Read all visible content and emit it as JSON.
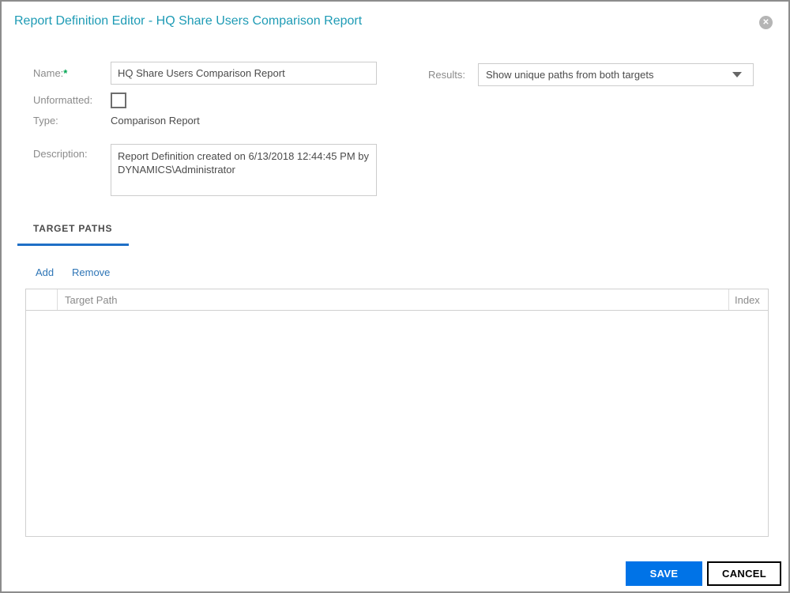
{
  "dialog": {
    "title": "Report Definition Editor - HQ Share Users Comparison Report",
    "close_icon": "circle-x-icon",
    "close_glyph": "✕"
  },
  "form": {
    "name": {
      "label": "Name:",
      "required_marker": "*",
      "value": "HQ Share Users Comparison Report"
    },
    "results": {
      "label": "Results:",
      "value": "Show unique paths from both targets"
    },
    "unformatted": {
      "label": "Unformatted:",
      "checked": false
    },
    "type": {
      "label": "Type:",
      "value": "Comparison Report"
    },
    "description": {
      "label": "Description:",
      "value": "Report Definition created on 6/13/2018 12:44:45 PM by DYNAMICS\\Administrator"
    }
  },
  "tabs": [
    {
      "label": "TARGET PATHS",
      "active": true
    }
  ],
  "toolbar": {
    "add_label": "Add",
    "remove_label": "Remove"
  },
  "table": {
    "columns": [
      "",
      "Target Path",
      "Index"
    ],
    "rows": []
  },
  "footer": {
    "save_label": "SAVE",
    "cancel_label": "CANCEL"
  },
  "colors": {
    "title_teal": "#1e9bb5",
    "accent_blue": "#0073e7",
    "tab_underline_blue": "#1f6fc6",
    "link_blue": "#2e75b6",
    "required_green": "#00a651"
  }
}
